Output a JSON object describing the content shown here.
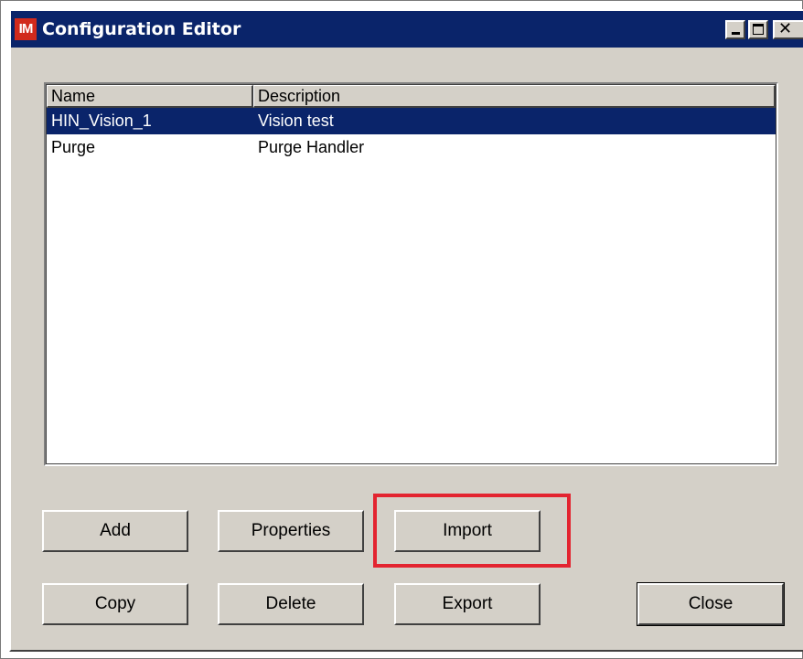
{
  "window": {
    "app_icon_text": "IM",
    "title": "Configuration Editor",
    "controls": {
      "minimize_icon": "minimize-icon",
      "maximize_icon": "maximize-icon",
      "close_icon": "close-icon",
      "close_glyph": "✕"
    }
  },
  "list": {
    "columns": [
      "Name",
      "Description"
    ],
    "rows": [
      {
        "name": "HIN_Vision_1",
        "description": "Vision test",
        "selected": true
      },
      {
        "name": "Purge",
        "description": "Purge Handler",
        "selected": false
      }
    ]
  },
  "buttons": {
    "add": "Add",
    "properties": "Properties",
    "import": "Import",
    "copy": "Copy",
    "delete": "Delete",
    "export": "Export",
    "close": "Close"
  },
  "colors": {
    "title_bar": "#0a246a",
    "dialog_face": "#d4d0c8",
    "selection": "#0a246a",
    "highlight_box": "#e32430",
    "app_icon": "#d12a1c"
  }
}
